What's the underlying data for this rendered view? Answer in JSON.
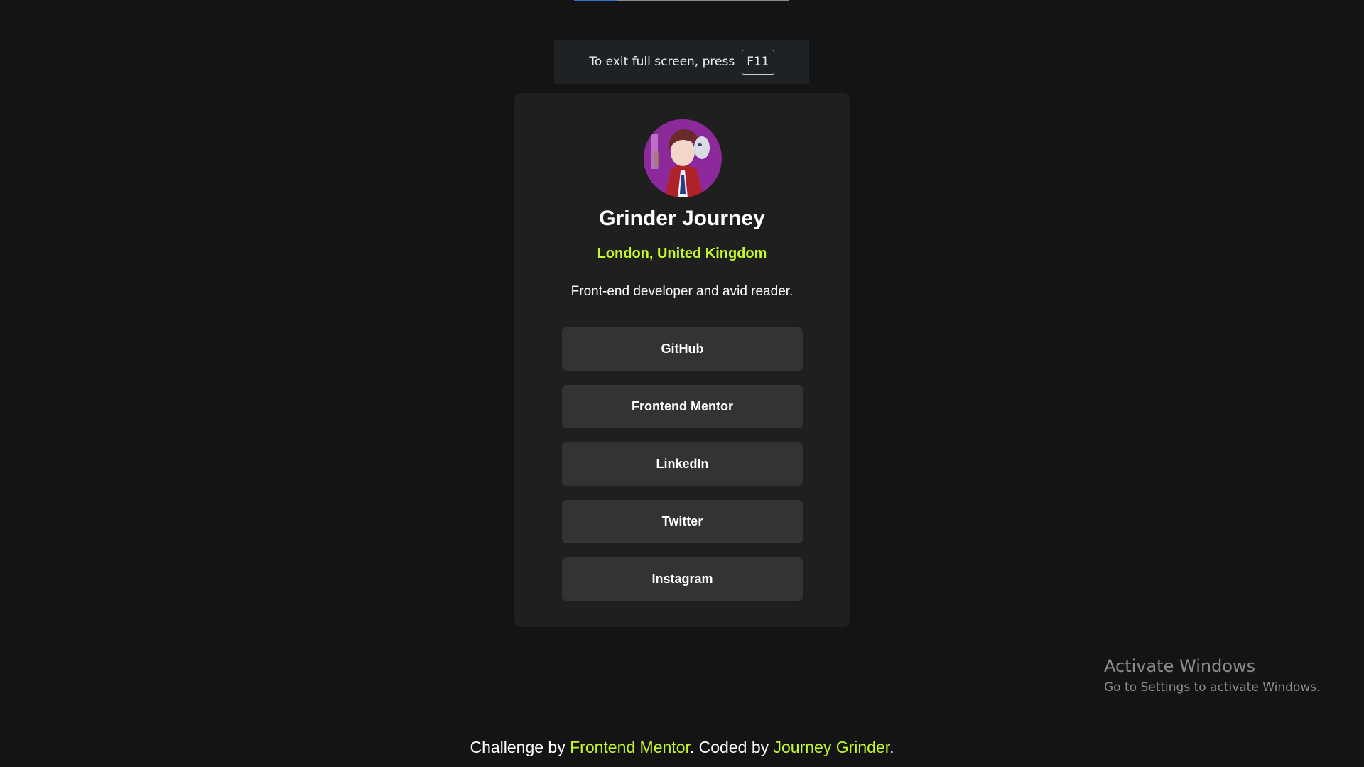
{
  "fullscreen_notice": {
    "text": "To exit full screen, press",
    "key": "F11"
  },
  "top_progress": {
    "fill_percent": 20
  },
  "profile": {
    "name": "Grinder Journey",
    "location": "London, United Kingdom",
    "bio": "Front-end developer and avid reader."
  },
  "links": [
    {
      "label": "GitHub"
    },
    {
      "label": "Frontend Mentor"
    },
    {
      "label": "LinkedIn"
    },
    {
      "label": "Twitter"
    },
    {
      "label": "Instagram"
    }
  ],
  "footer": {
    "prefix": "Challenge by ",
    "challenge_link": "Frontend Mentor",
    "middle": ". Coded by ",
    "author_link": "Journey Grinder",
    "suffix": "."
  },
  "windows_watermark": {
    "title": "Activate Windows",
    "subtitle": "Go to Settings to activate Windows."
  },
  "colors": {
    "background": "#141414",
    "card": "#1f1f1f",
    "button": "#333333",
    "accent": "#c4f82a",
    "text": "#ffffff"
  }
}
